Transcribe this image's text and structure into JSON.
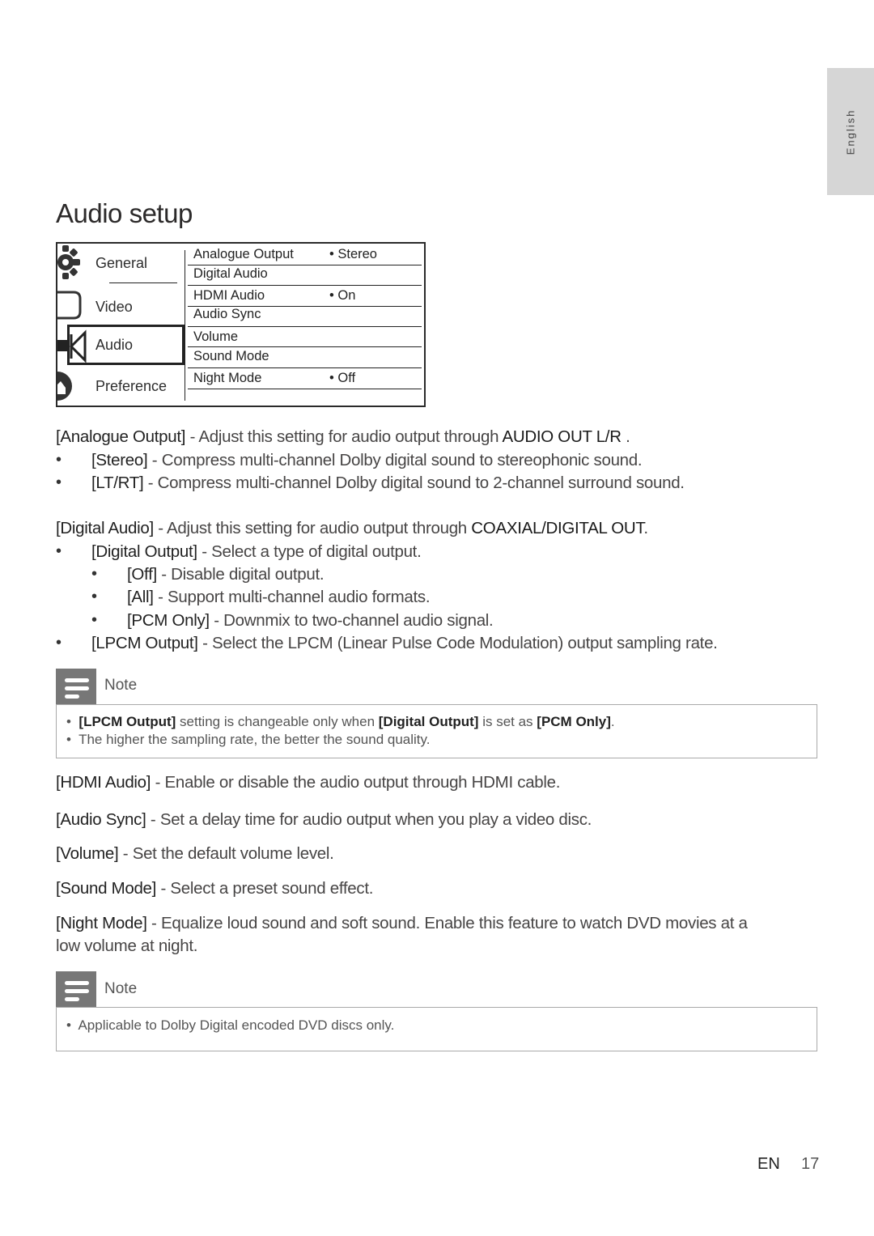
{
  "side_tab": {
    "language": "English"
  },
  "page_title": "Audio setup",
  "menu": {
    "categories": [
      {
        "label": "General",
        "icon": "gear-icon"
      },
      {
        "label": "Video",
        "icon": "screen-icon"
      },
      {
        "label": "Audio",
        "icon": "speaker-icon",
        "selected": true
      },
      {
        "label": "Preference",
        "icon": "preference-icon"
      }
    ],
    "items": [
      {
        "label": "Analogue Output",
        "value": "• Stereo"
      },
      {
        "label": "Digital Audio",
        "value": ""
      },
      {
        "label": "HDMI Audio",
        "value": "• On"
      },
      {
        "label": "Audio Sync",
        "value": ""
      },
      {
        "label": "Volume",
        "value": ""
      },
      {
        "label": "Sound Mode",
        "value": ""
      },
      {
        "label": "Night Mode",
        "value": "• Off"
      }
    ]
  },
  "sections": {
    "analogue": {
      "term": "[Analogue Output]",
      "text": " - Adjust this setting for audio output through ",
      "strong": "AUDIO OUT L/R",
      "end": " .",
      "options": [
        {
          "term": "[Stereo]",
          "text": " - Compress multi-channel Dolby digital sound to stereophonic sound."
        },
        {
          "term": "[LT/RT]",
          "text": " - Compress multi-channel Dolby digital sound to 2-channel surround sound."
        }
      ]
    },
    "digital": {
      "term": "[Digital Audio]",
      "text": " - Adjust this setting for audio output through ",
      "strong": "COAXIAL/DIGITAL OUT",
      "end": ".",
      "digital_output": {
        "term": "[Digital Output]",
        "text": " - Select a type of digital output."
      },
      "sub_options": [
        {
          "term": "[Off]",
          "text": " - Disable digital output."
        },
        {
          "term": "[All]",
          "text": " - Support multi-channel audio formats."
        },
        {
          "term": "[PCM Only]",
          "text": " - Downmix to two-channel audio signal."
        }
      ],
      "lpcm": {
        "term": "[LPCM Output]",
        "text": " - Select the LPCM (Linear Pulse Code Modulation) output sampling rate."
      }
    },
    "hdmi": {
      "term": "[HDMI Audio]",
      "text": " - Enable or disable the audio output through HDMI cable."
    },
    "sync": {
      "term": "[Audio Sync]",
      "text": " - Set a delay time for audio output when you play a video disc."
    },
    "volume": {
      "term": "[Volume]",
      "text": " - Set the default volume level."
    },
    "sound_mode": {
      "term": "[Sound Mode]",
      "text": " - Select a preset sound effect."
    },
    "night_mode": {
      "term": "[Night Mode]",
      "text": " - Equalize loud sound and soft sound. Enable this feature to watch DVD movies at a",
      "text2": "low volume at night."
    }
  },
  "note1": {
    "label": "Note",
    "line1": {
      "t1": "[LPCM Output]",
      "t2": " setting is changeable only when ",
      "t3": "[Digital Output]",
      "t4": " is set as ",
      "t5": "[PCM Only]",
      "t6": "."
    },
    "line2": "The higher the sampling rate, the better the sound quality."
  },
  "note2": {
    "label": "Note",
    "line1": "Applicable to Dolby Digital encoded DVD discs only."
  },
  "footer": {
    "lang": "EN",
    "page": "17"
  }
}
